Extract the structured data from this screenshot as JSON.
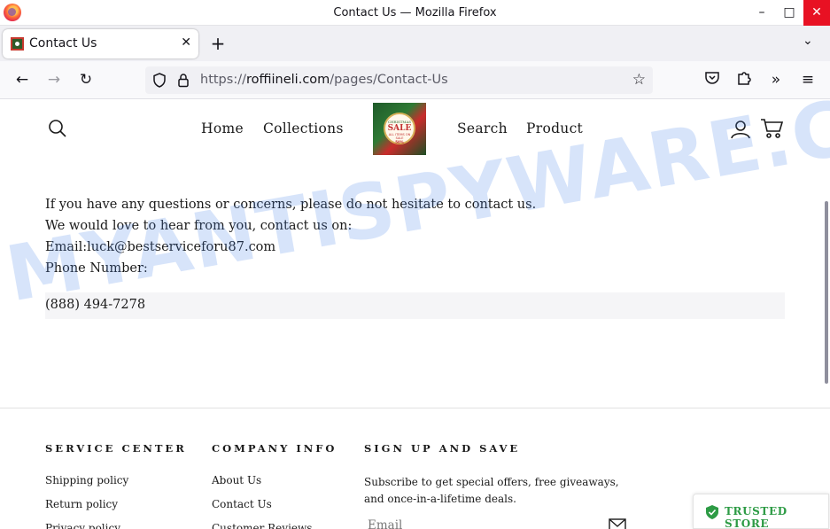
{
  "window": {
    "title": "Contact Us — Mozilla Firefox",
    "minimize_icon": "minimize-icon",
    "maximize_icon": "maximize-icon",
    "close_icon": "close-icon"
  },
  "tabs": [
    {
      "label": "Contact Us",
      "active": true
    }
  ],
  "navbar": {
    "url_scheme": "https://",
    "url_host": "roffiineli.com",
    "url_path": "/pages/Contact-Us"
  },
  "site": {
    "menu": [
      "Home",
      "Collections",
      "Search",
      "Product"
    ],
    "logo": {
      "line1": "CHRISTMAS",
      "line2": "SALE",
      "line3": "ALL ITEMS ON SALE",
      "line4": "50%"
    },
    "contact_lines": [
      "If you have any questions or concerns, please do not hesitate to contact us.",
      "We would love to hear from you, contact us on:",
      "Email:luck@bestserviceforu87.com",
      "Phone Number:"
    ],
    "phone": "(888) 494-7278"
  },
  "footer": {
    "service_center": {
      "heading": "SERVICE CENTER",
      "links": [
        "Shipping policy",
        "Return policy",
        "Privacy policy"
      ]
    },
    "company_info": {
      "heading": "COMPANY INFO",
      "links": [
        "About Us",
        "Contact Us",
        "Customer Reviews"
      ]
    },
    "signup": {
      "heading": "SIGN UP AND SAVE",
      "description": "Subscribe to get special offers, free giveaways, and once-in-a-lifetime deals.",
      "email_placeholder": "Email"
    }
  },
  "trusted_badge": "TRUSTED STORE",
  "watermark": "MYANTISPYWARE.COM",
  "colors": {
    "close_button": "#e81123",
    "trusted_green": "#2d9b45",
    "watermark_blue": "#4a84ea"
  }
}
